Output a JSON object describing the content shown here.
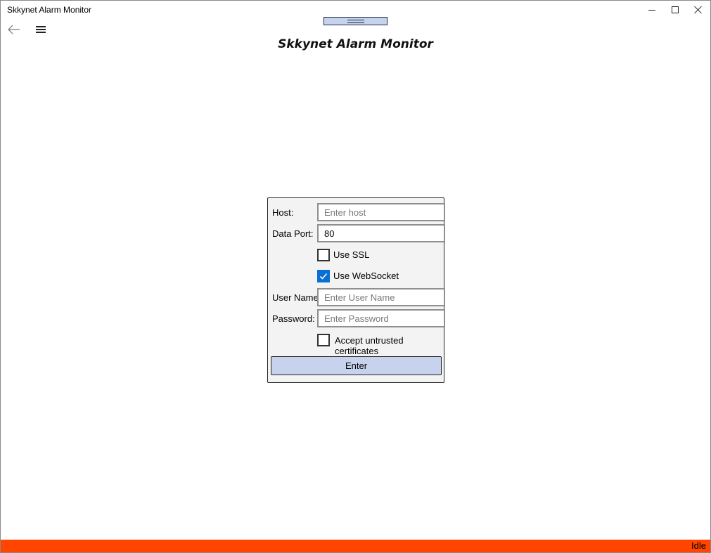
{
  "window": {
    "title": "Skkynet Alarm Monitor"
  },
  "header": {
    "app_title": "Skkynet Alarm Monitor",
    "icons": [
      "back-arrow-icon",
      "hamburger-menu-icon"
    ]
  },
  "login": {
    "host_label": "Host:",
    "host_placeholder": "Enter host",
    "host_value": "",
    "port_label": "Data Port:",
    "port_value": "80",
    "ssl_label": "Use SSL",
    "ssl_checked": false,
    "websocket_label": "Use WebSocket",
    "websocket_checked": true,
    "username_label": "User Name:",
    "username_placeholder": "Enter User Name",
    "password_label": "Password:",
    "password_placeholder": "Enter Password",
    "untrusted_label": "Accept untrusted certificates",
    "untrusted_checked": false,
    "enter_label": "Enter"
  },
  "status": {
    "text": "Idle",
    "color": "#ff4500"
  },
  "colors": {
    "accent": "#0a6fd4",
    "button_bg": "#c7d3ec"
  }
}
